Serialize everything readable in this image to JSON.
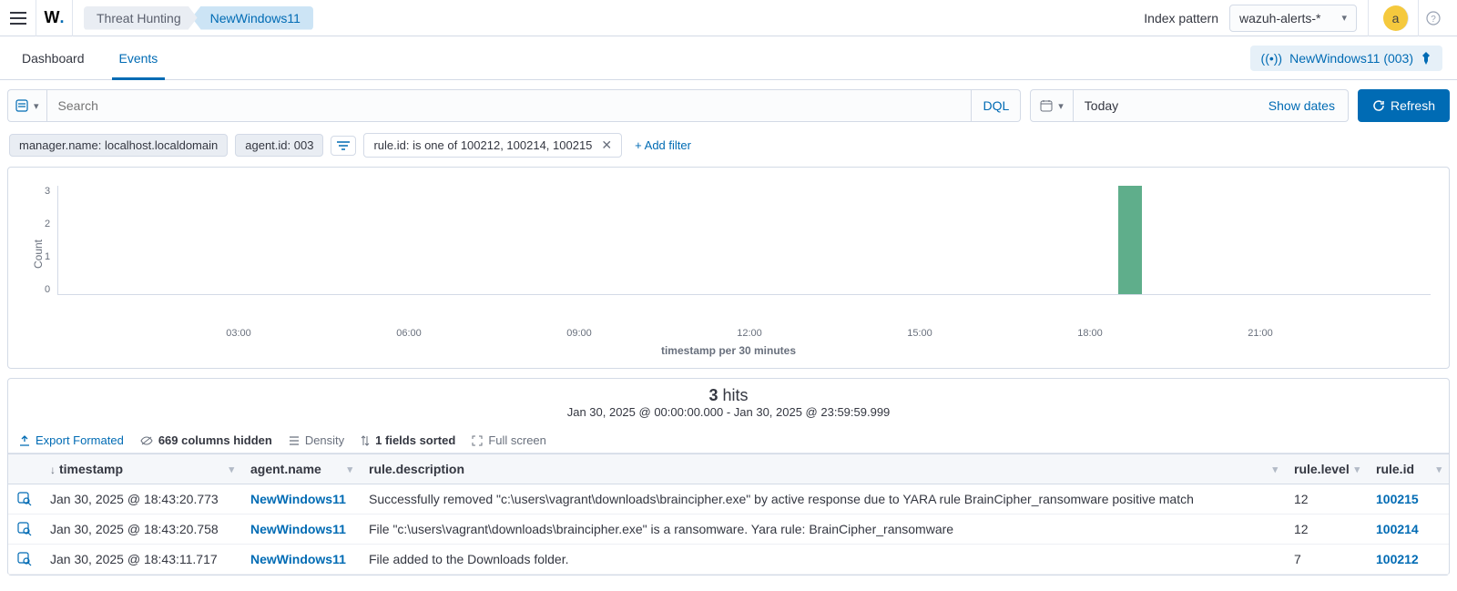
{
  "topbar": {
    "breadcrumbs": [
      "Threat Hunting",
      "NewWindows11"
    ],
    "index_pattern_label": "Index pattern",
    "index_pattern_value": "wazuh-alerts-*",
    "avatar_letter": "a"
  },
  "tabs": {
    "dashboard": "Dashboard",
    "events": "Events",
    "active": "events"
  },
  "agent_pin": {
    "label": "NewWindows11 (003)"
  },
  "search": {
    "placeholder": "Search",
    "dql_label": "DQL"
  },
  "date": {
    "value": "Today",
    "show_dates": "Show dates"
  },
  "refresh_label": "Refresh",
  "filters": {
    "pinned": [
      "manager.name: localhost.localdomain",
      "agent.id: 003"
    ],
    "removable": "rule.id: is one of 100212, 100214, 100215",
    "add_filter": "+ Add filter"
  },
  "chart_data": {
    "type": "bar",
    "title": "",
    "ylabel": "Count",
    "xlabel": "timestamp per 30 minutes",
    "ylim": [
      0,
      3
    ],
    "yticks": [
      0,
      1,
      2,
      3
    ],
    "xticks": [
      "03:00",
      "06:00",
      "09:00",
      "12:00",
      "15:00",
      "18:00",
      "21:00"
    ],
    "x_range_hours": [
      0,
      24
    ],
    "bars": [
      {
        "x_hour": 18.75,
        "value": 3
      }
    ]
  },
  "hits": {
    "count": "3",
    "count_suffix": "hits",
    "range": "Jan 30, 2025 @ 00:00:00.000 - Jan 30, 2025 @ 23:59:59.999"
  },
  "toolbar": {
    "export": "Export Formated",
    "hidden_cols": "669 columns hidden",
    "density": "Density",
    "sorted": "1 fields sorted",
    "fullscreen": "Full screen"
  },
  "columns": {
    "timestamp": "timestamp",
    "agent_name": "agent.name",
    "rule_description": "rule.description",
    "rule_level": "rule.level",
    "rule_id": "rule.id"
  },
  "rows": [
    {
      "timestamp": "Jan 30, 2025 @ 18:43:20.773",
      "agent_name": "NewWindows11",
      "rule_description": "Successfully removed \"c:\\users\\vagrant\\downloads\\braincipher.exe\" by active response due to YARA rule BrainCipher_ransomware positive match",
      "rule_level": "12",
      "rule_id": "100215"
    },
    {
      "timestamp": "Jan 30, 2025 @ 18:43:20.758",
      "agent_name": "NewWindows11",
      "rule_description": "File \"c:\\users\\vagrant\\downloads\\braincipher.exe\" is a ransomware. Yara rule: BrainCipher_ransomware",
      "rule_level": "12",
      "rule_id": "100214"
    },
    {
      "timestamp": "Jan 30, 2025 @ 18:43:11.717",
      "agent_name": "NewWindows11",
      "rule_description": "File added to the Downloads folder.",
      "rule_level": "7",
      "rule_id": "100212"
    }
  ]
}
